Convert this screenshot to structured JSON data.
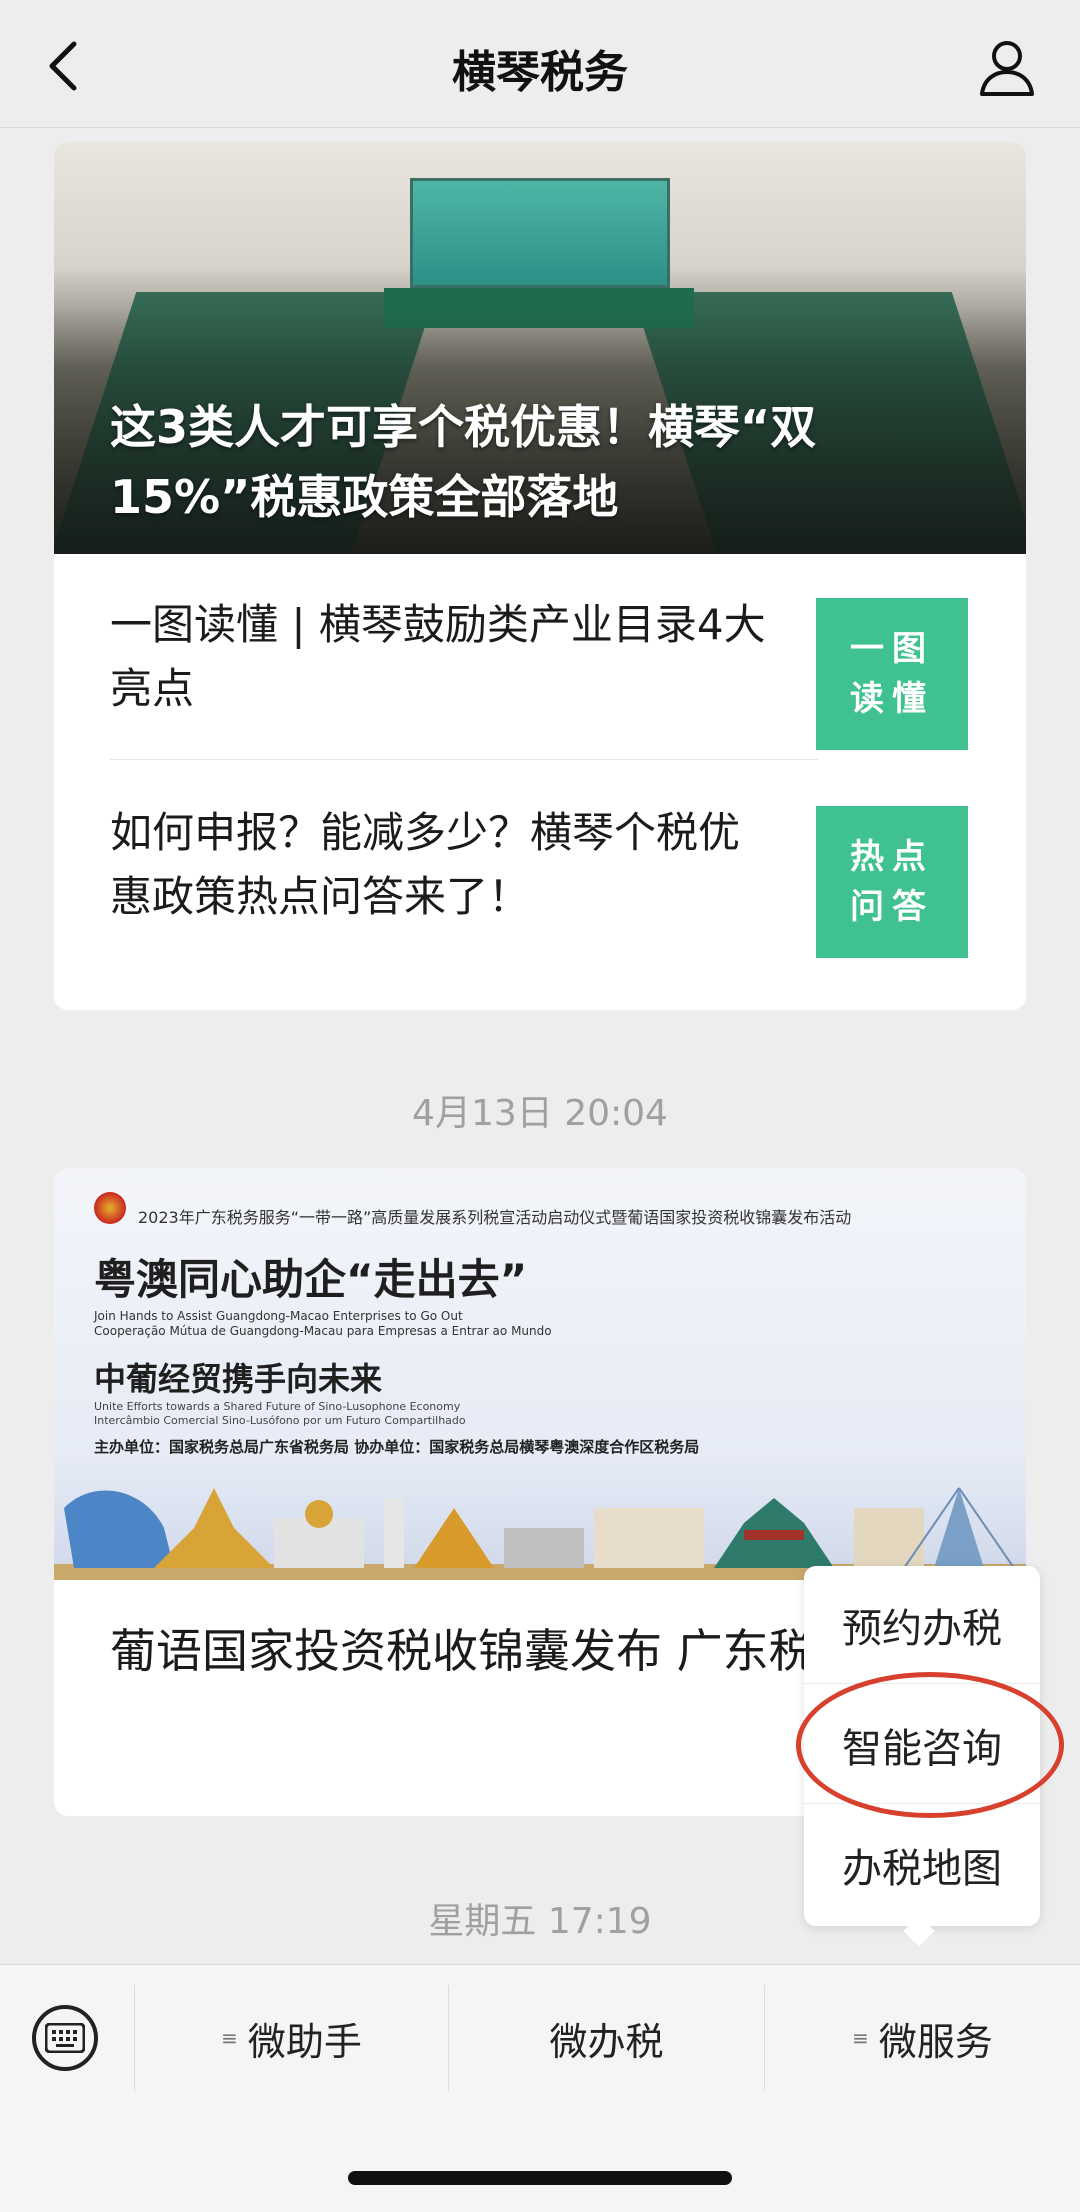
{
  "header": {
    "title": "横琴税务"
  },
  "articles": [
    {
      "headline": "这3类人才可享个税优惠！横琴“双15%”税惠政策全部落地",
      "items": [
        {
          "title": "一图读懂 | 横琴鼓励类产业目录4大亮点",
          "thumb_text": "一图读懂"
        },
        {
          "title": "如何申报？能减多少？横琴个税优惠政策热点问答来了！",
          "thumb_text": "热点问答"
        }
      ]
    },
    {
      "timestamp": "4月13日 20:04",
      "banner": {
        "top_line": "2023年广东税务服务“一带一路”高质量发展系列税宣活动启动仪式暨葡语国家投资税收锦囊发布活动",
        "heading": "粤澳同心助企“走出去”",
        "en_line1": "Join Hands to Assist Guangdong-Macao Enterprises to Go Out",
        "en_line2": "Cooperação Mútua de Guangdong-Macau para Empresas a Entrar ao Mundo",
        "heading2": "中葡经贸携手向未来",
        "en_line3": "Unite Efforts towards a Shared Future of Sino-Lusophone Economy",
        "en_line4": "Intercâmbio Comercial Sino-Lusófono por um Futuro Compartilhado",
        "host_line": "主办单位：国家税务总局广东省税务局   协办单位：国家税务总局横琴粤澳深度合作区税务局"
      },
      "headline": "葡语国家投资税收锦囊发布 广东税务服务“一带一路”高质量发展系列"
    }
  ],
  "timestamp2": "星期五 17:19",
  "popup_menu": {
    "items": [
      "预约办税",
      "智能咨询",
      "办税地图"
    ]
  },
  "bottom_bar": {
    "tabs": [
      "微助手",
      "微办税",
      "微服务"
    ]
  },
  "colors": {
    "thumb_green": "#3fc28f",
    "highlight_red": "#d8402e",
    "background": "#ededed"
  }
}
